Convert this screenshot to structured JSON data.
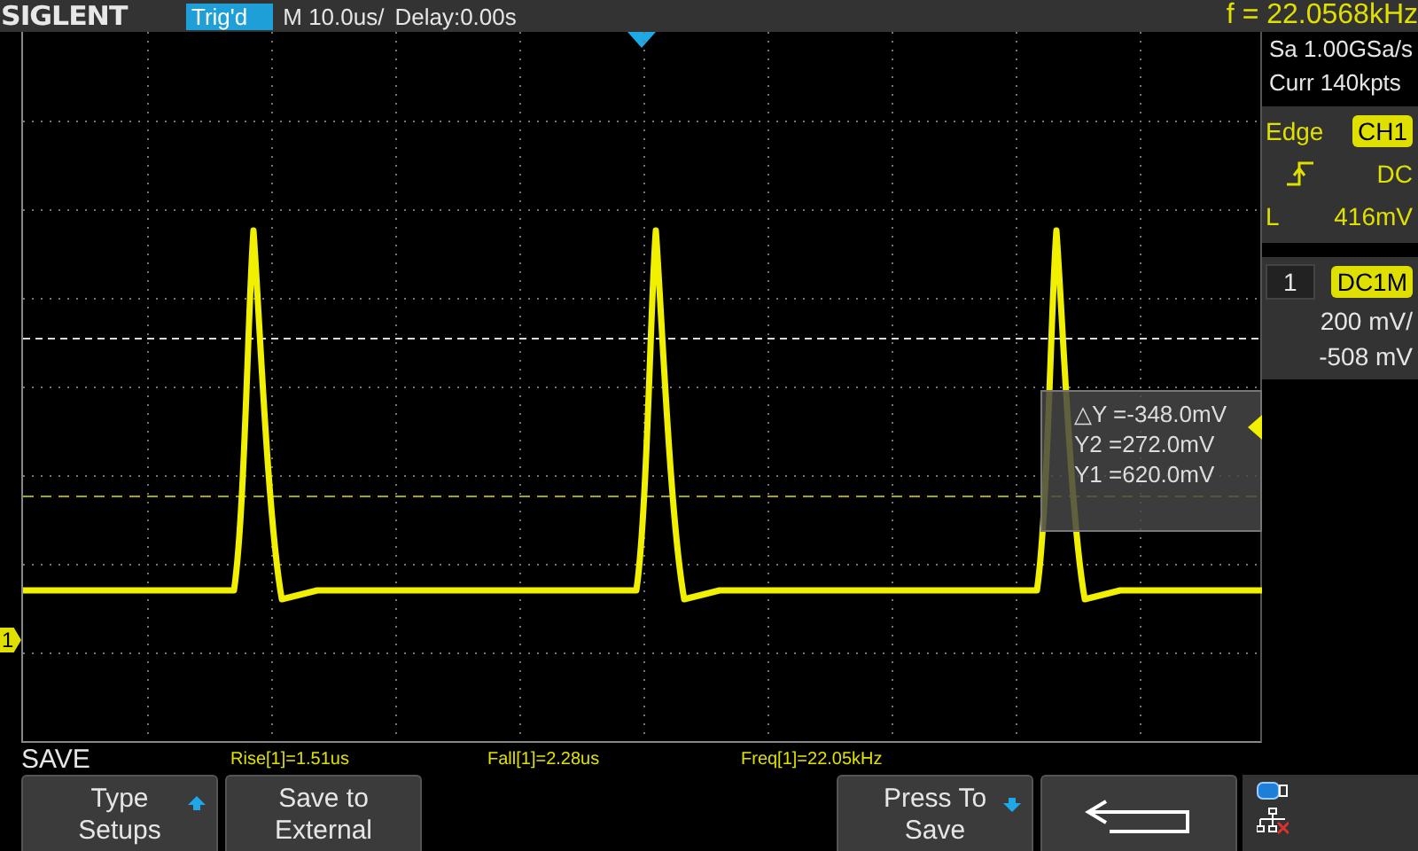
{
  "top_bar": {
    "logo": "SIGLENT",
    "trigger_status": "Trig'd",
    "timebase": "M 10.0us/",
    "delay": "Delay:0.00s",
    "frequency": "f = 22.0568kHz"
  },
  "channel_marker": {
    "label": "1"
  },
  "cursor_readout": [
    "△Y =-348.0mV",
    "Y2 =272.0mV",
    "Y1 =620.0mV"
  ],
  "acquisition": {
    "sample_rate": "Sa 1.00GSa/s",
    "memory_depth": "Curr 140kpts"
  },
  "trigger": {
    "type": "Edge",
    "source": "CH1",
    "coupling": "DC",
    "level_label": "L",
    "level": "416mV"
  },
  "channel": {
    "number": "1",
    "coupling": "DC1M",
    "scale": "200 mV/",
    "offset": "-508 mV"
  },
  "menu_title": "SAVE",
  "measurements": [
    "Rise[1]=1.51us",
    "Fall[1]=2.28us",
    "Freq[1]=22.05kHz"
  ],
  "softkeys": [
    {
      "kind": "cycle",
      "lines": [
        "Type",
        "Setups"
      ]
    },
    {
      "kind": "label",
      "lines": [
        "Save to",
        "External"
      ]
    },
    {
      "kind": "empty"
    },
    {
      "kind": "empty"
    },
    {
      "kind": "action",
      "lines": [
        "Press To",
        "Save"
      ]
    },
    {
      "kind": "back"
    }
  ]
}
